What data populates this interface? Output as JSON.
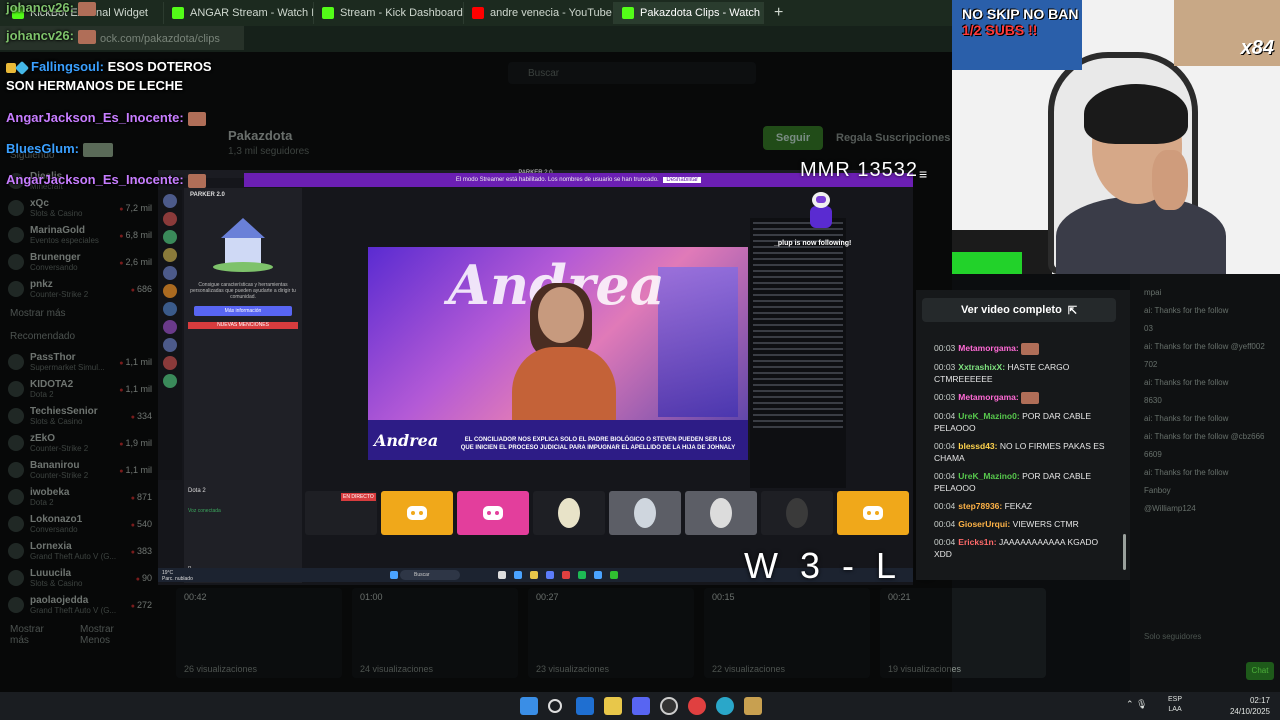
{
  "browser": {
    "tabs": [
      {
        "label": "KickBot External Widget"
      },
      {
        "label": "ANGAR Stream - Watch Live on"
      },
      {
        "label": "Stream - Kick Dashboard"
      },
      {
        "label": "andre venecia - YouTube"
      },
      {
        "label": "Pakazdota Clips - Watch Liv"
      }
    ],
    "url": "ock.com/pakazdota/clips"
  },
  "kick": {
    "search_placeholder": "Buscar",
    "channel_name": "Pakazdota",
    "followers": "1,3 mil seguidores",
    "follow_button": "Seguir",
    "subscribe_button": "Regala Suscripciones",
    "nav_sections": {
      "following": "Siguiendo",
      "recommended": "Recomendado",
      "show_more": "Mostrar más",
      "show_less": "Mostrar Menos"
    },
    "following": [
      {
        "name": "Diealis",
        "category": "Minecraft",
        "count": "8 mil"
      },
      {
        "name": "xQc",
        "category": "Slots & Casino",
        "count": "7,2 mil"
      },
      {
        "name": "MarinaGold",
        "category": "Eventos especiales",
        "count": "6,8 mil"
      },
      {
        "name": "Brunenger",
        "category": "Conversando",
        "count": "2,6 mil"
      },
      {
        "name": "pnkz",
        "category": "Counter-Strike 2",
        "count": "686"
      }
    ],
    "recommended": [
      {
        "name": "PassThor",
        "category": "Supermarket Simul...",
        "count": "1,1 mil"
      },
      {
        "name": "KIDOTA2",
        "category": "Dota 2",
        "count": "1,1 mil"
      },
      {
        "name": "TechiesSenior",
        "category": "Slots & Casino",
        "count": "334"
      },
      {
        "name": "zEkO",
        "category": "Counter-Strike 2",
        "count": "1,9 mil"
      },
      {
        "name": "Bananirou",
        "category": "Counter-Strike 2",
        "count": "1,1 mil"
      },
      {
        "name": "iwobeka",
        "category": "Dota 2",
        "count": "871"
      },
      {
        "name": "Lokonazo1",
        "category": "Conversando",
        "count": "540"
      },
      {
        "name": "Lornexia",
        "category": "Grand Theft Auto V (G...",
        "count": "383"
      },
      {
        "name": "Luuucila",
        "category": "Slots & Casino",
        "count": "90"
      },
      {
        "name": "paolaojedda",
        "category": "Grand Theft Auto V (G...",
        "count": "272"
      }
    ],
    "clips": [
      {
        "duration": "00:42",
        "views": "26 visualizaciones"
      },
      {
        "duration": "01:00",
        "views": "24 visualizaciones"
      },
      {
        "duration": "00:27",
        "views": "23 visualizaciones"
      },
      {
        "duration": "00:15",
        "views": "22 visualizaciones"
      },
      {
        "duration": "00:21",
        "views": "19 visualizaciones"
      }
    ]
  },
  "share": {
    "window_title": "PARKER 2.0",
    "streamer_mode_notice": "El modo Streamer está habilitado. Los nombres de usuario se han truncado.",
    "disable_label": "Deshabilitar",
    "server_name": "PARKER 2.0",
    "discord_text": "Consigue características y herramientas personalizadas que pueden ayudarte a dirigir tu comunidad.",
    "more_info": "Más información",
    "new_mentions": "NUEVAS MENCIONES",
    "game": "Dota 2",
    "voice_connected": "Voz conectada",
    "live_label": "EN DIRECTO",
    "new_follow": "_plup is now following!",
    "video_show": "Andrea",
    "video_caption": "EL CONCILIADOR NOS EXPLICA SOLO EL PADRE BIOLÓGICO O STEVEN PUEDEN SER LOS QUE INICIEN EL PROCESO JUDICIAL PARA IMPUGNAR EL APELLIDO DE LA HIJA DE JOHNALY",
    "taskbar_search": "Buscar",
    "weather": "19°C",
    "weather_desc": "Parc. nublado"
  },
  "overlay": {
    "mmr": "MMR 13532",
    "record": "W 3 - L 5",
    "chat": [
      {
        "user": "johancv26:",
        "color": "#7ec26b",
        "message": ""
      },
      {
        "user": "johancv26:",
        "color": "#7ec26b",
        "message": ""
      },
      {
        "user": "Fallingsoul:",
        "color": "#3aa0ff",
        "message": "ESOS DOTEROS"
      },
      {
        "user": "",
        "color": "#ffffff",
        "message": "SON HERMANOS DE LECHE"
      },
      {
        "user": "AngarJackson_Es_Inocente:",
        "color": "#c77dff",
        "message": ""
      },
      {
        "user": "BluesGlum:",
        "color": "#3aa0ff",
        "message": ""
      },
      {
        "user": "AngarJackson_Es_Inocente:",
        "color": "#c77dff",
        "message": ""
      }
    ]
  },
  "cam": {
    "banner_line1": "NO SKIP NO BAN",
    "banner_line2": "1/2 SUBS !!",
    "multiplier": "x84"
  },
  "panel": {
    "view_full": "Ver video completo",
    "messages": [
      {
        "time": "00:03",
        "user": "Metamorgama:",
        "color": "#ff6ad5",
        "text": "",
        "emote": true
      },
      {
        "time": "00:03",
        "user": "XxtrashixX:",
        "color": "#7ee07e",
        "text": "HASTE CARGO CTMREEEEEE",
        "emote": false
      },
      {
        "time": "00:03",
        "user": "Metamorgama:",
        "color": "#ff6ad5",
        "text": "",
        "emote": true
      },
      {
        "time": "00:04",
        "user": "UreK_Mazino0:",
        "color": "#57c84d",
        "text": "POR DAR CABLE PELAOOO",
        "emote": false
      },
      {
        "time": "00:04",
        "user": "blessd43:",
        "color": "#ffd34d",
        "text": "NO LO FIRMES PAKAS ES CHAMA",
        "emote": false
      },
      {
        "time": "00:04",
        "user": "UreK_Mazino0:",
        "color": "#57c84d",
        "text": "POR DAR CABLE PELAOOO",
        "emote": false
      },
      {
        "time": "00:04",
        "user": "step78936:",
        "color": "#ffb347",
        "text": "FEKAZ",
        "emote": false
      },
      {
        "time": "00:04",
        "user": "GioserUrqui:",
        "color": "#ffb347",
        "text": "VIEWERS CTMR",
        "emote": false
      },
      {
        "time": "00:04",
        "user": "Ericks1n:",
        "color": "#ff6a6a",
        "text": "JAAAAAAAAAAA KGADO XDD",
        "emote": false
      }
    ],
    "side_messages": [
      "mpai",
      "ai: Thanks for the follow",
      "03",
      "ai: Thanks for the follow @yeff002",
      "702",
      "ai: Thanks for the follow",
      "8630",
      "ai: Thanks for the follow",
      "ai: Thanks for the follow @cbz666",
      "6609",
      "ai: Thanks for the follow",
      "Fanboy",
      "@Williamp124"
    ],
    "slow_mode": "Solo seguidores",
    "chat_button": "Chat"
  },
  "taskbar": {
    "lang": "ESP",
    "lang2": "LAA",
    "time": "02:17",
    "date": "24/10/2025"
  }
}
